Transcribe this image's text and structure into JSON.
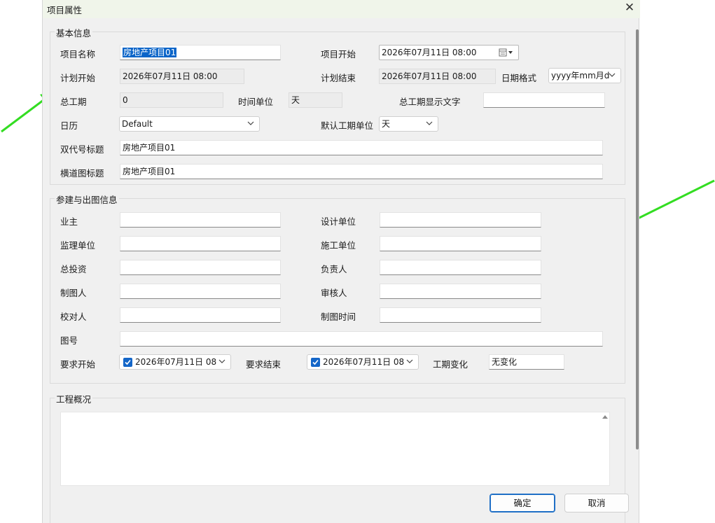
{
  "dialog": {
    "title": "项目属性",
    "close_glyph": "✕"
  },
  "basic": {
    "legend": "基本信息",
    "project_name_label": "项目名称",
    "project_name_value": "房地产项目01",
    "project_start_label": "项目开始",
    "project_start_value": "2026年07月11日 08:00",
    "plan_start_label": "计划开始",
    "plan_start_value": "2026年07月11日 08:00",
    "plan_end_label": "计划结束",
    "plan_end_value": "2026年07月11日 08:00",
    "date_format_label": "日期格式",
    "date_format_value": "yyyy年mm月d",
    "total_duration_label": "总工期",
    "total_duration_value": "0",
    "time_unit_label": "时间单位",
    "time_unit_value": "天",
    "duration_text_label": "总工期显示文字",
    "duration_text_value": "",
    "calendar_label": "日历",
    "calendar_value": "Default",
    "default_unit_label": "默认工期单位",
    "default_unit_value": "天",
    "double_code_title_label": "双代号标题",
    "double_code_title_value": "房地产项目01",
    "lane_chart_title_label": "横道图标题",
    "lane_chart_title_value": "房地产项目01"
  },
  "build": {
    "legend": "参建与出图信息",
    "owner_label": "业主",
    "owner_value": "",
    "design_unit_label": "设计单位",
    "design_unit_value": "",
    "supervision_unit_label": "监理单位",
    "supervision_unit_value": "",
    "construction_unit_label": "施工单位",
    "construction_unit_value": "",
    "total_investment_label": "总投资",
    "total_investment_value": "",
    "responsible_label": "负责人",
    "responsible_value": "",
    "drafter_label": "制图人",
    "drafter_value": "",
    "reviewer_label": "审核人",
    "reviewer_value": "",
    "proofreader_label": "校对人",
    "proofreader_value": "",
    "draw_time_label": "制图时间",
    "draw_time_value": "",
    "drawing_no_label": "图号",
    "drawing_no_value": "",
    "req_start_label": "要求开始",
    "req_start_value": "2026年07月11日 08",
    "req_start_checked": true,
    "req_end_label": "要求结束",
    "req_end_value": "2026年07月11日 08",
    "req_end_checked": true,
    "duration_change_label": "工期变化",
    "duration_change_value": "无变化"
  },
  "overview": {
    "legend": "工程概况",
    "text": ""
  },
  "buttons": {
    "ok": "确定",
    "cancel": "取消"
  },
  "icons": {
    "chevron": "chevron-down-icon",
    "calendar": "calendar-icon",
    "checkbox": "checkmark-icon",
    "close": "close-icon"
  },
  "colors": {
    "title_bar": "#f0f5ea",
    "dialog_bg": "#f0f0f0",
    "selection": "#0a64c8",
    "checkbox": "#1466c8",
    "annotation_arrow": "#33dd22",
    "primary_border": "#1f6fc6"
  }
}
